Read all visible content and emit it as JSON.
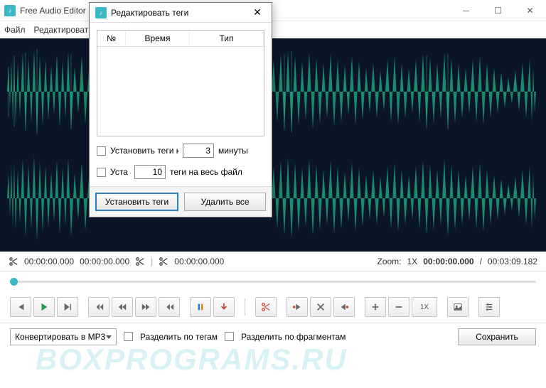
{
  "window": {
    "title": "Free Audio Editor",
    "menu": {
      "file": "Файл",
      "edit": "Редактировать"
    }
  },
  "dialog": {
    "title": "Редактировать теги",
    "columns": {
      "num": "№",
      "time": "Время",
      "type": "Тип"
    },
    "row1": {
      "check_label": "Установить теги к",
      "value": "3",
      "unit": "минуты"
    },
    "row2": {
      "check_label": "Уста",
      "value": "10",
      "unit": "теги на весь файл"
    },
    "set_btn": "Установить теги",
    "delete_btn": "Удалить все"
  },
  "timebar": {
    "t1": "00:00:00.000",
    "t2": "00:00:00.000",
    "t3": "00:00:00.000",
    "zoom_label": "Zoom:",
    "zoom_value": "1X",
    "pos": "00:00:00.000",
    "sep": "/",
    "dur": "00:03:09.182"
  },
  "toolbar": {
    "zoom_text": "1X"
  },
  "bottom": {
    "convert": "Конвертировать в MP3",
    "split_tags": "Разделить по тегам",
    "split_frag": "Разделить по фрагментам",
    "save": "Сохранить"
  },
  "watermark": "BOXPROGRAMS.RU"
}
